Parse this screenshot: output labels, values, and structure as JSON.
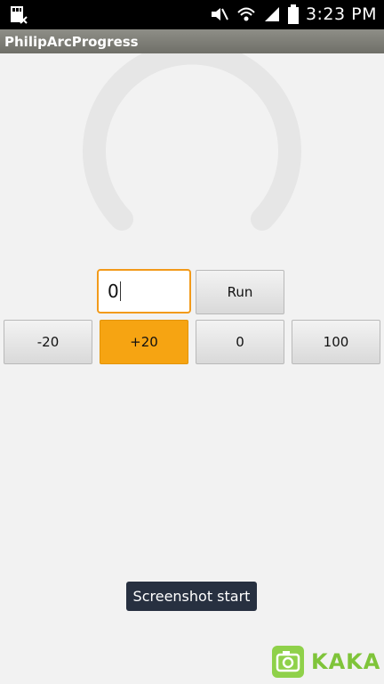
{
  "status_bar": {
    "time": "3:23 PM",
    "icons": [
      "sd-card-icon",
      "mute-icon",
      "wifi-icon",
      "signal-icon",
      "battery-icon"
    ]
  },
  "app": {
    "title": "PhilipArcProgress"
  },
  "arc_progress": {
    "value": 0,
    "track_color": "#e6e6e6"
  },
  "controls": {
    "input_value": "0",
    "run_label": "Run",
    "buttons": [
      "-20",
      "+20",
      "0",
      "100"
    ],
    "accent_color": "#f6a412"
  },
  "toast": {
    "text": "Screenshot start"
  },
  "watermark": {
    "text": "KAKA"
  }
}
